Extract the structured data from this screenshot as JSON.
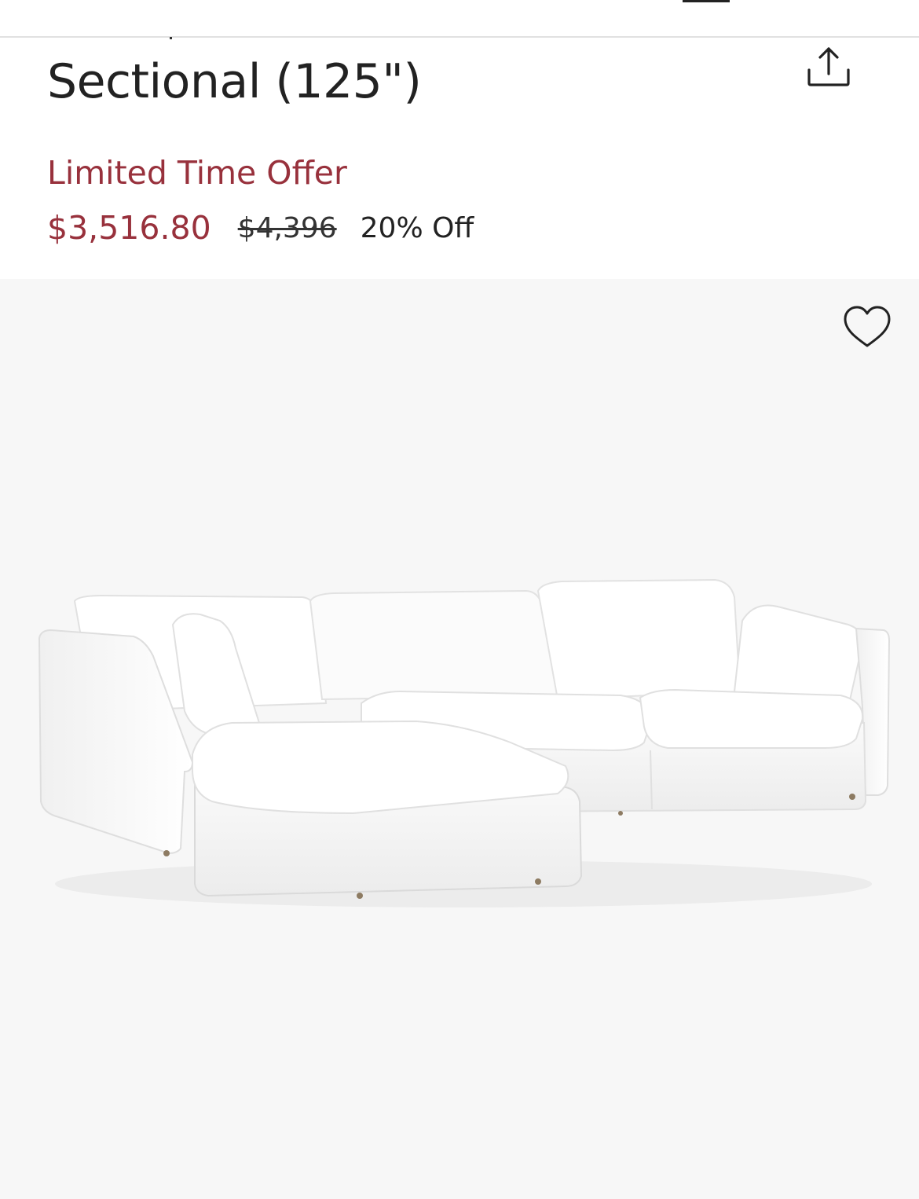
{
  "product": {
    "title": "Sectional (125\")",
    "promo_label": "Limited Time Offer",
    "sale_price": "$3,516.80",
    "original_price": "$4,396",
    "discount": "20% Off"
  },
  "icons": {
    "share": "share-icon",
    "favorite": "heart-icon"
  },
  "colors": {
    "accent": "#98313c",
    "text": "#222222",
    "image_background": "#f7f7f7"
  }
}
